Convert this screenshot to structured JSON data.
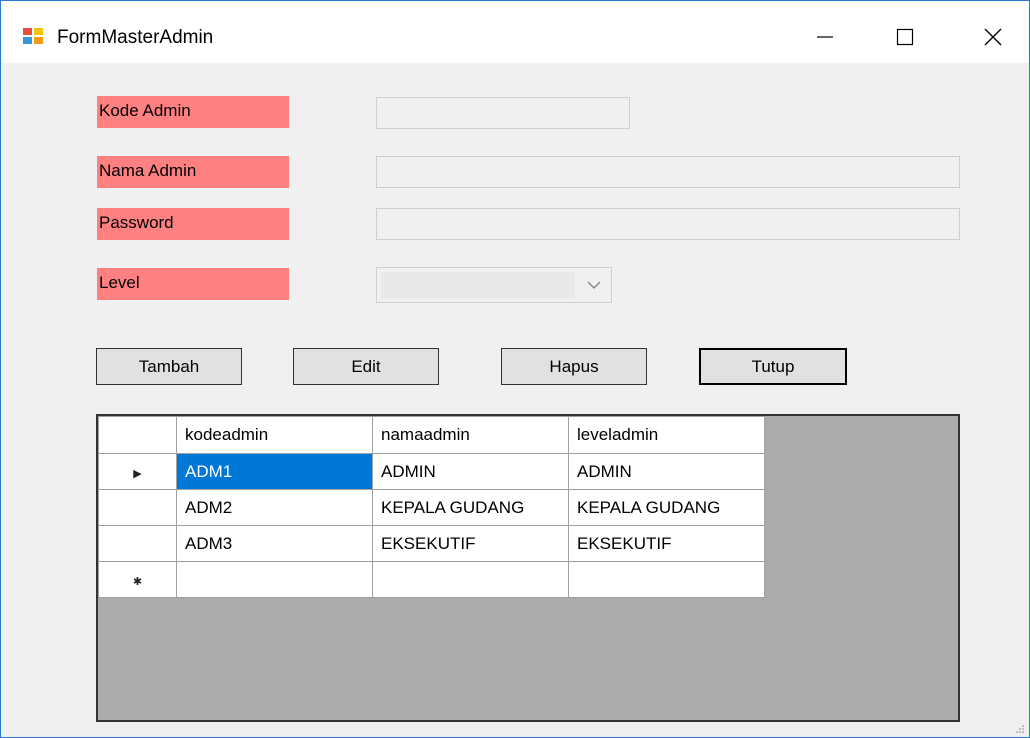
{
  "window": {
    "title": "FormMasterAdmin",
    "minimize_glyph": "—",
    "maximize_glyph": "☐",
    "close_glyph": "✕",
    "border_color": "#2b79d0"
  },
  "form": {
    "kode_admin_label": "Kode Admin",
    "nama_admin_label": "Nama Admin",
    "password_label": "Password",
    "level_label": "Level",
    "kode_admin_value": "",
    "nama_admin_value": "",
    "password_value": "",
    "level_value": "",
    "label_background": "#ff8080"
  },
  "buttons": {
    "tambah": "Tambah",
    "edit": "Edit",
    "hapus": "Hapus",
    "tutup": "Tutup"
  },
  "grid": {
    "columns": [
      "kodeadmin",
      "namaadmin",
      "leveladmin"
    ],
    "rows": [
      [
        "ADM1",
        "ADMIN",
        "ADMIN"
      ],
      [
        "ADM2",
        "KEPALA GUDANG",
        "KEPALA GUDANG"
      ],
      [
        "ADM3",
        "EKSEKUTIF",
        "EKSEKUTIF"
      ]
    ],
    "current_row_glyph": "▶",
    "new_row_glyph": "✱",
    "selection_color": "#0078d7",
    "background": "#ababab"
  }
}
